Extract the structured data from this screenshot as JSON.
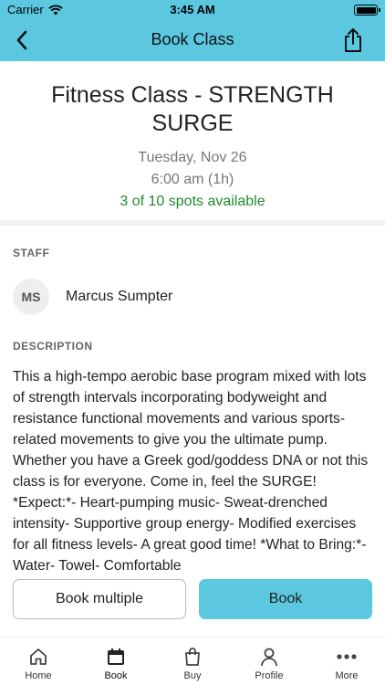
{
  "status_bar": {
    "carrier": "Carrier",
    "time": "3:45 AM"
  },
  "nav": {
    "title": "Book Class"
  },
  "class_info": {
    "title": "Fitness Class - STRENGTH SURGE",
    "date": "Tuesday, Nov 26",
    "time": "6:00 am (1h)",
    "spots": "3 of 10 spots available"
  },
  "staff": {
    "label": "STAFF",
    "initials": "MS",
    "name": "Marcus Sumpter"
  },
  "description": {
    "label": "DESCRIPTION",
    "text": "This a high-tempo aerobic base program mixed with lots of strength intervals incorporating bodyweight and resistance functional movements and various sports-related movements to give you the ultimate pump. Whether you have a Greek god/goddess DNA or not this class is for everyone. Come in, feel the SURGE!   *Expect:*- Heart-pumping music- Sweat-drenched intensity- Supportive group energy- Modified exercises for all fitness levels- A great good time! *What to Bring:*- Water- Towel- Comfortable"
  },
  "actions": {
    "book_multiple": "Book multiple",
    "book": "Book"
  },
  "tabs": [
    {
      "label": "Home",
      "icon": "home-icon"
    },
    {
      "label": "Book",
      "icon": "calendar-icon"
    },
    {
      "label": "Buy",
      "icon": "shopping-bag-icon"
    },
    {
      "label": "Profile",
      "icon": "person-icon"
    },
    {
      "label": "More",
      "icon": "more-icon"
    }
  ],
  "colors": {
    "accent": "#5bc8e0",
    "available": "#1f8a2f"
  }
}
